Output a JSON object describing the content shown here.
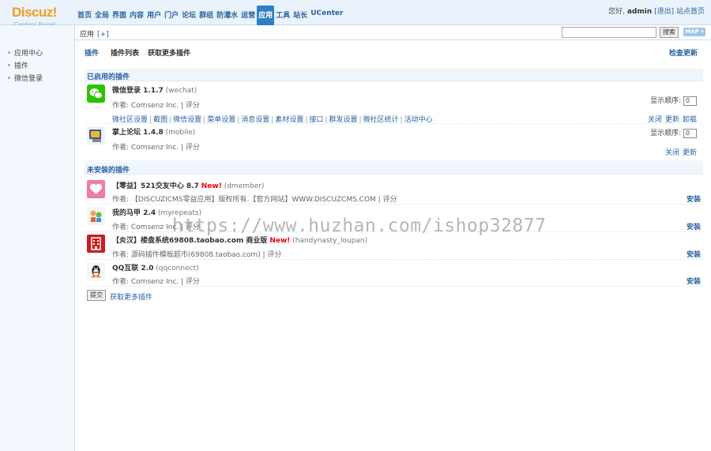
{
  "header": {
    "logo": "Discuz!",
    "logo_sub": "Control Panel",
    "nav": [
      "首页",
      "全局",
      "界面",
      "内容",
      "用户",
      "门户",
      "论坛",
      "群组",
      "防灌水",
      "运营",
      "应用",
      "工具",
      "站长",
      "UCenter"
    ],
    "nav_active": "应用",
    "user": {
      "greeting": "您好,",
      "name": "admin",
      "logout": "[退出]",
      "home": "站点首页"
    }
  },
  "subbar": {
    "crumb": "应用",
    "plus": "[+]",
    "search_button": "搜索",
    "map_button": "MAP"
  },
  "sidebar": {
    "items": [
      "应用中心",
      "插件",
      "微信登录"
    ]
  },
  "tabs": {
    "items": [
      "插件",
      "插件列表",
      "获取更多插件"
    ],
    "check_update": "检查更新"
  },
  "enabled": {
    "heading": "已启用的插件",
    "plugins": [
      {
        "title": "微信登录 1.1.7",
        "id": "(wechat)",
        "author": "作者: Comsenz Inc. | 评分",
        "order_label": "显示顺序:",
        "order_value": "0",
        "links": [
          "微社区设置",
          "截图",
          "微信设置",
          "菜单设置",
          "消息设置",
          "素材设置",
          "接口",
          "群发设置",
          "微社区统计",
          "活动中心"
        ],
        "actions": [
          "关闭",
          "更新",
          "卸载"
        ]
      },
      {
        "title": "掌上论坛 1.4.8",
        "id": "(mobile)",
        "author": "作者: Comsenz Inc. | 评分",
        "order_label": "显示顺序:",
        "order_value": "0",
        "actions": [
          "关闭",
          "更新"
        ]
      }
    ]
  },
  "uninstalled": {
    "heading": "未安装的插件",
    "install_label": "安装",
    "plugins": [
      {
        "title": "【零益】521交友中心 8.7",
        "new": "New!",
        "id": "(dmember)",
        "author": "作者: 【DISCUZICMS零益应用】版权所有.【官方网站】WWW.DISCUZCMS.COM | 评分"
      },
      {
        "title": "我的马甲 2.4",
        "id": "(myrepeats)",
        "author": "作者: Comsenz Inc. | 评分"
      },
      {
        "title": "【炎汉】楼盘系统69808.taobao.com 商业版",
        "new": "New!",
        "id": "(handynasty_loupan)",
        "author": "作者: 源码插件模板超市(69808.taobao.com) | 评分"
      },
      {
        "title": "QQ互联 2.0",
        "id": "(qqconnect)",
        "author": "作者: Comsenz Inc. | 评分"
      }
    ]
  },
  "footer": {
    "submit": "提交",
    "more": "获取更多插件"
  },
  "watermark": "https://www.huzhan.com/ishop32877",
  "colors": {
    "accent": "#2b62a3",
    "nav_active_bg": "#2e80c6",
    "logo": "#f29b1c",
    "new": "#ee0000"
  },
  "icons": [
    "wechat-icon",
    "mobile-icon",
    "heart-icon",
    "vest-icon",
    "building-icon",
    "qq-penguin-icon"
  ]
}
